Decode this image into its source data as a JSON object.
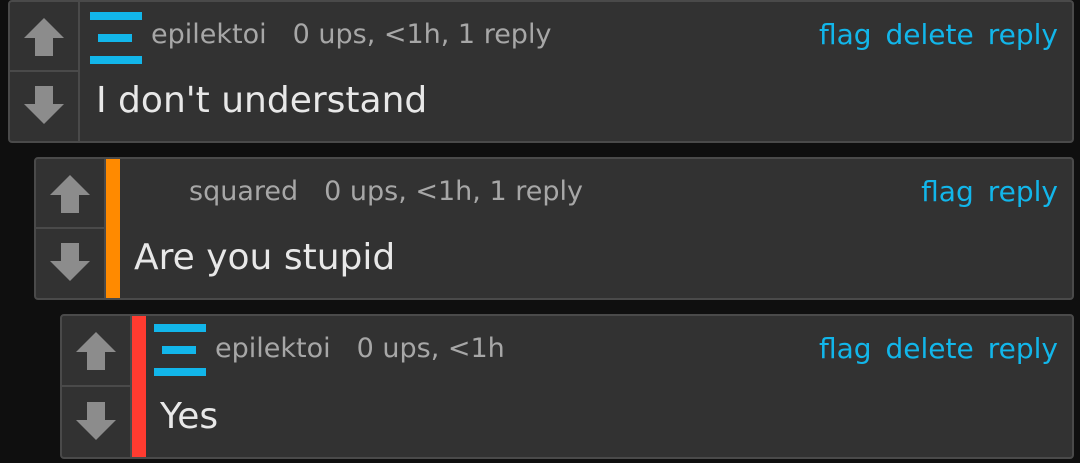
{
  "colors": {
    "accent": "#12b6ea",
    "depth_orange": "#ff8a00",
    "depth_red": "#ff3b30",
    "panel": "#323232",
    "border": "#4a4a4a"
  },
  "comments": [
    {
      "user": "epilektoi",
      "info": "0 ups, <1h, 1 reply",
      "actions": {
        "flag": "flag",
        "delete": "delete",
        "reply": "reply"
      },
      "text": "I don't understand"
    },
    {
      "user": "squared",
      "info": "0 ups, <1h, 1 reply",
      "actions": {
        "flag": "flag",
        "reply": "reply"
      },
      "text": "Are you stupid"
    },
    {
      "user": "epilektoi",
      "info": "0 ups, <1h",
      "actions": {
        "flag": "flag",
        "delete": "delete",
        "reply": "reply"
      },
      "text": "Yes"
    }
  ],
  "icons": {
    "upvote": "arrow-up-icon",
    "downvote": "arrow-down-icon",
    "avatar": "user-avatar-icon"
  }
}
